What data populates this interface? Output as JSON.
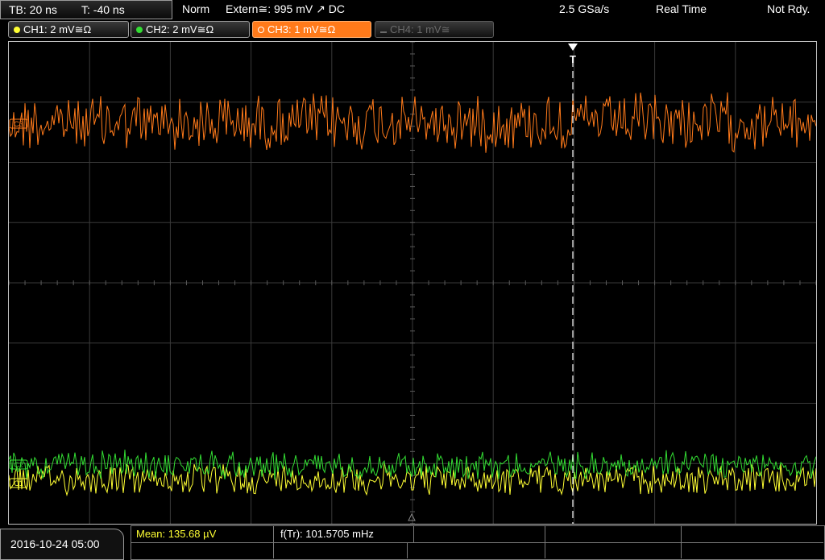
{
  "timebase": {
    "tb": "TB: 20 ns",
    "t": "T: -40 ns"
  },
  "status": {
    "mode": "Norm",
    "trigger": "Extern≅: 995 mV ↗ DC",
    "sample_rate": "2.5 GSa/s",
    "acquisition": "Real Time",
    "ready": "Not Rdy."
  },
  "channels": [
    {
      "label": "CH1: 2 mV≅Ω",
      "color": "#ffff33",
      "state": "on"
    },
    {
      "label": "CH2: 2 mV≅Ω",
      "color": "#33dd33",
      "state": "on"
    },
    {
      "label": "CH3: 1 mV≅Ω",
      "color": "#ff7a1a",
      "state": "selected"
    },
    {
      "label": "CH4: 1 mV≅",
      "color": "#6a6a6a",
      "state": "off"
    }
  ],
  "markers": {
    "trigger_label": "T",
    "ch1": "C1",
    "ch2": "C2",
    "ch3": "C3"
  },
  "date": "2016-10-24 05:00",
  "measurements": {
    "mean": "Mean: 135.68 µV",
    "freq": "f(Tr): 101.5705 mHz"
  }
}
